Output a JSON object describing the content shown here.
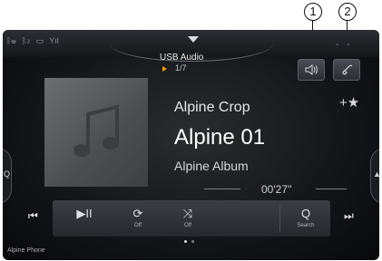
{
  "callouts": [
    "1",
    "2"
  ],
  "header": {
    "source_label": "USB Audio",
    "track_counter": "1/7",
    "menu_dash": "- -"
  },
  "status_bar": {
    "icons": [
      "bluetooth-phone-icon",
      "bluetooth-audio-icon",
      "battery-icon",
      "signal-icon"
    ]
  },
  "top_buttons": [
    {
      "name": "audio-setup-button",
      "icon": "speaker-icon"
    },
    {
      "name": "phone-button",
      "icon": "phone-icon"
    }
  ],
  "track": {
    "artist": "Alpine Crop",
    "title": "Alpine 01",
    "album": "Alpine Album",
    "elapsed": "00'27''"
  },
  "favorite": {
    "icon": "add-favorite-star-icon",
    "glyph": "+★"
  },
  "side_tabs": {
    "left_glyph": "Q",
    "right_glyph": "▲"
  },
  "controls": {
    "prev_glyph": "⏮",
    "next_glyph": "⏭",
    "play_pause_glyph": "▶II",
    "repeat_glyph": "⟳",
    "repeat_label": "Off",
    "shuffle_glyph": "⤨",
    "shuffle_label": "Off",
    "search_glyph": "Q",
    "search_label": "Search"
  },
  "pager": {
    "pages": 2,
    "active": 0
  },
  "footer": {
    "text": "Alpine Phone"
  },
  "colors": {
    "accent": "#f0a000",
    "background": "#15161a",
    "text": "#ffffff"
  }
}
